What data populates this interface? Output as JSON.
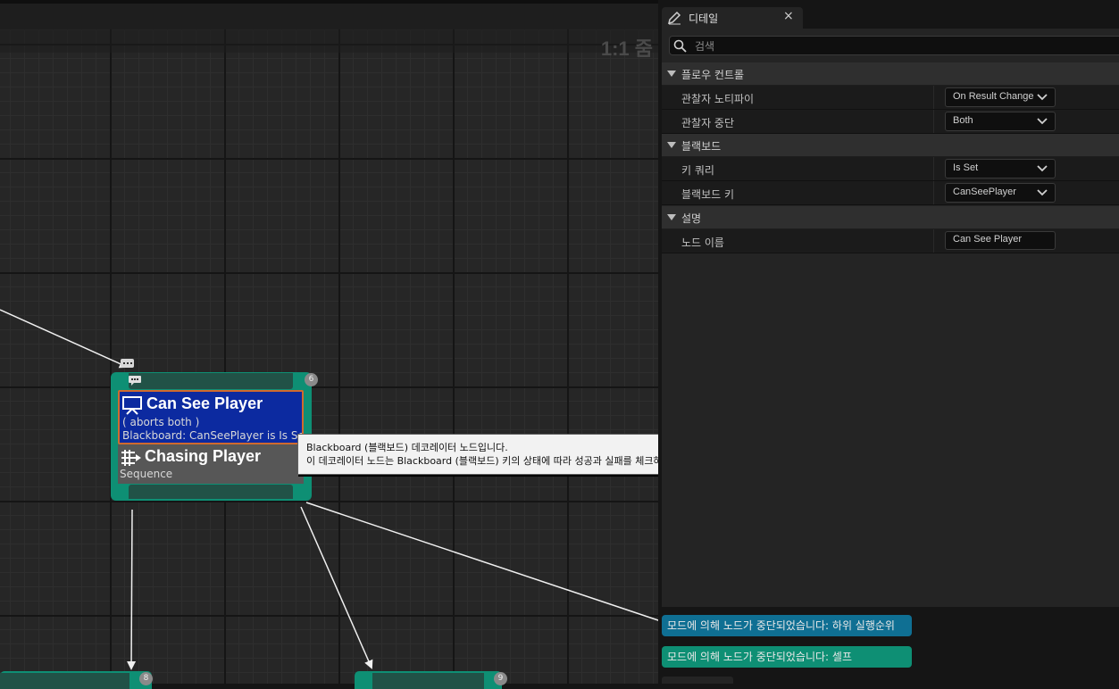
{
  "graph": {
    "zoom_label": "1:1 줌",
    "node": {
      "index_badge": "6",
      "decorator": {
        "title": "Can See Player",
        "line1": "( aborts both )",
        "line2": "Blackboard: CanSeePlayer is Is Set"
      },
      "composite": {
        "title": "Chasing Player",
        "type": "Sequence"
      }
    },
    "tooltip": {
      "line1": "Blackboard (블랙보드) 데코레이터 노드입니다.",
      "line2": "이 데코레이터 노드는 Blackboard (블랙보드) 키의 상태에 따라 성공과 실패를 체크하게 됩니다."
    },
    "child_nodes": [
      {
        "index_badge": "8"
      },
      {
        "index_badge": "9"
      }
    ]
  },
  "details": {
    "tab_title": "디테일",
    "tab_close": "×",
    "search_placeholder": "검색",
    "categories": [
      {
        "label": "플로우 컨트롤",
        "properties": [
          {
            "label": "관찰자 노티파이",
            "value": "On Result Change",
            "kind": "combo"
          },
          {
            "label": "관찰자 중단",
            "value": "Both",
            "kind": "combo"
          }
        ]
      },
      {
        "label": "블랙보드",
        "properties": [
          {
            "label": "키 쿼리",
            "value": "Is Set",
            "kind": "combo"
          },
          {
            "label": "블랙보드 키",
            "value": "CanSeePlayer",
            "kind": "combo"
          }
        ]
      },
      {
        "label": "설명",
        "properties": [
          {
            "label": "노드 이름",
            "value": "Can See Player",
            "kind": "text"
          }
        ]
      }
    ]
  },
  "notifications": [
    {
      "text": "모드에 의해 노드가 중단되었습니다: 하위 실행순위"
    },
    {
      "text": "모드에 의해 노드가 중단되었습니다: 셀프"
    }
  ],
  "colors": {
    "decorator_bg": "#0c2aa0",
    "node_border": "#0e8f74",
    "composite_bg": "#575757",
    "notify_lower_priority": "#0f6f93",
    "notify_self": "#0e8f74"
  }
}
